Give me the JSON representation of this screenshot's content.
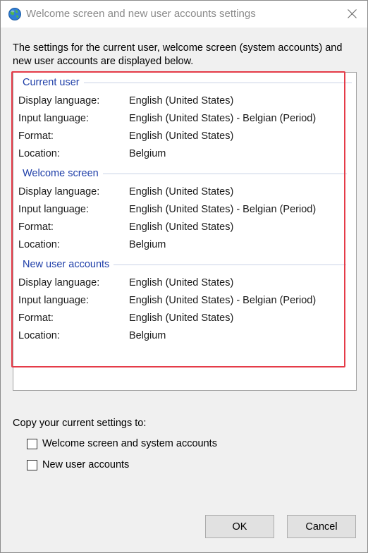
{
  "window": {
    "title": "Welcome screen and new user accounts settings"
  },
  "intro_text": "The settings for the current user, welcome screen (system accounts) and new user accounts are displayed below.",
  "groups": [
    {
      "heading": "Current user",
      "rows": [
        {
          "label": "Display language:",
          "value": "English (United States)"
        },
        {
          "label": "Input language:",
          "value": "English (United States) - Belgian (Period)"
        },
        {
          "label": "Format:",
          "value": "English (United States)"
        },
        {
          "label": "Location:",
          "value": "Belgium"
        }
      ]
    },
    {
      "heading": "Welcome screen",
      "rows": [
        {
          "label": "Display language:",
          "value": "English (United States)"
        },
        {
          "label": "Input language:",
          "value": "English (United States) - Belgian (Period)"
        },
        {
          "label": "Format:",
          "value": "English (United States)"
        },
        {
          "label": "Location:",
          "value": "Belgium"
        }
      ]
    },
    {
      "heading": "New user accounts",
      "rows": [
        {
          "label": "Display language:",
          "value": "English (United States)"
        },
        {
          "label": "Input language:",
          "value": "English (United States) - Belgian (Period)"
        },
        {
          "label": "Format:",
          "value": "English (United States)"
        },
        {
          "label": "Location:",
          "value": "Belgium"
        }
      ]
    }
  ],
  "copy_settings": {
    "label": "Copy your current settings to:",
    "options": [
      {
        "label": "Welcome screen and system accounts",
        "checked": false
      },
      {
        "label": "New user accounts",
        "checked": false
      }
    ]
  },
  "buttons": {
    "ok": "OK",
    "cancel": "Cancel"
  },
  "colors": {
    "group_heading": "#1e3ea8",
    "highlight_border": "#e53b48",
    "dialog_background": "#f0f0f0"
  },
  "icons": {
    "title": "globe-icon",
    "close": "close-icon"
  }
}
